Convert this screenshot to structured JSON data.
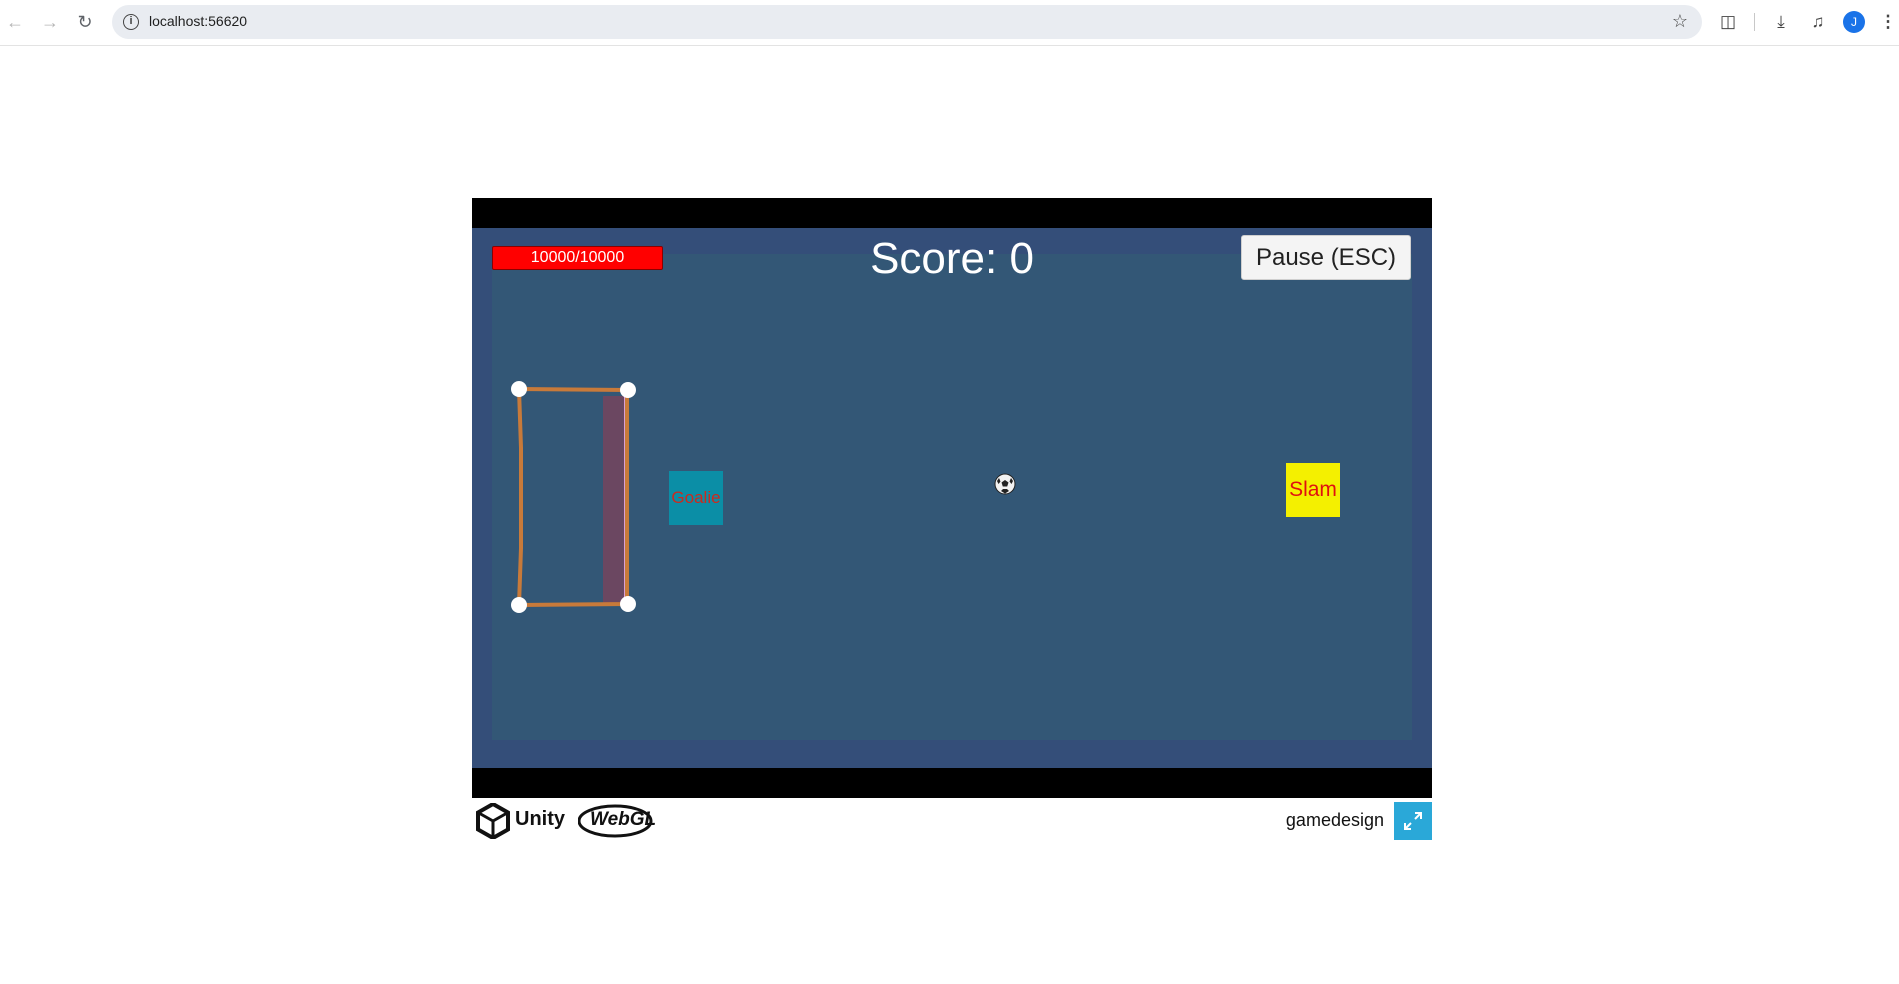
{
  "browser": {
    "url": "localhost:56620",
    "avatar_letter": "J"
  },
  "game": {
    "health_text": "10000/10000",
    "score_text": "Score: 0",
    "pause_label": "Pause (ESC)",
    "goalie_label": "Goalie",
    "slam_label": "Slam",
    "colors": {
      "health": "#ff0000",
      "goalie": "#0b8ea6",
      "slam": "#f4f000",
      "background": "#344e79",
      "field": "#335776",
      "goal_frame": "#c87a3a"
    }
  },
  "footer": {
    "unity_label": "Unity",
    "webgl_label": "WebGL",
    "game_name": "gamedesign"
  }
}
